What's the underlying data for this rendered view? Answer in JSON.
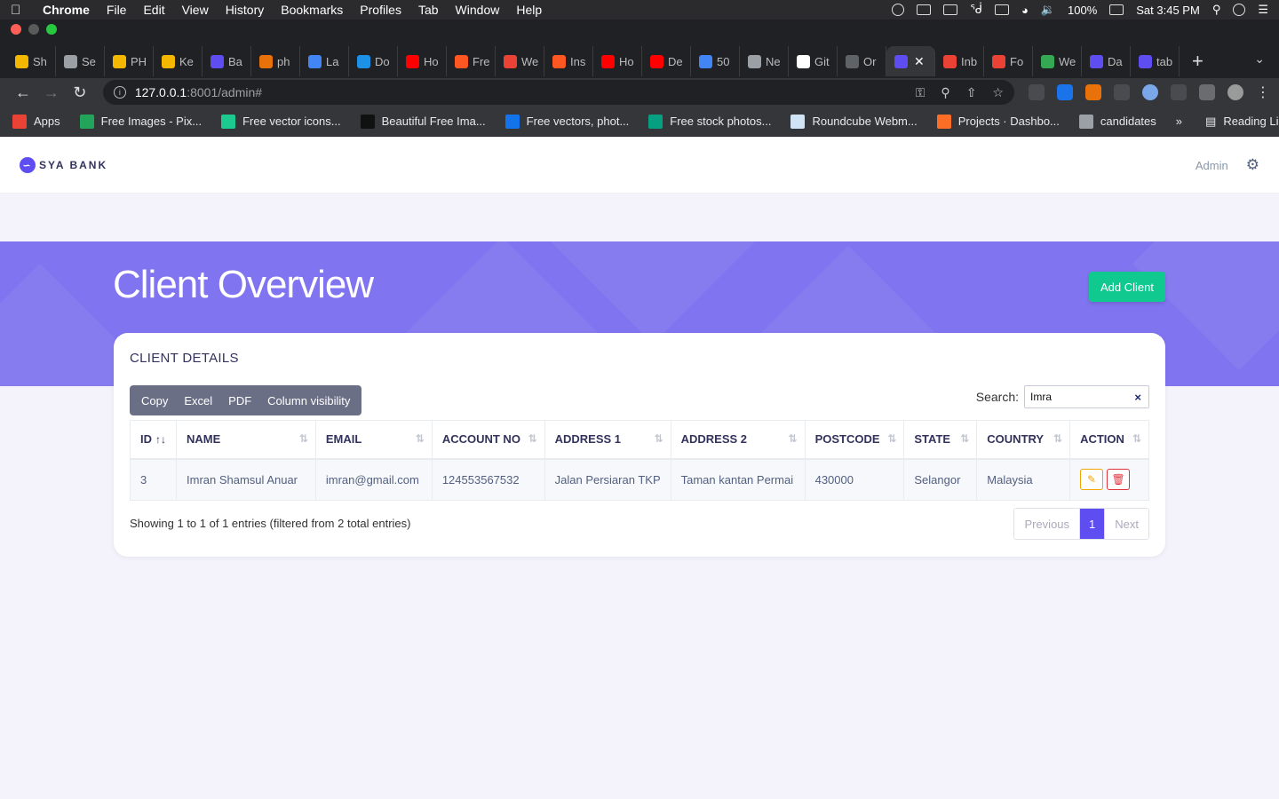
{
  "menubar": {
    "app": "Chrome",
    "items": [
      "File",
      "Edit",
      "View",
      "History",
      "Bookmarks",
      "Profiles",
      "Tab",
      "Window",
      "Help"
    ],
    "battery": "100%",
    "clock": "Sat 3:45 PM"
  },
  "tabs": [
    {
      "label": "Sh",
      "color": "#f5b800"
    },
    {
      "label": "Se",
      "color": "#9aa0a6"
    },
    {
      "label": "PH",
      "color": "#f5b800"
    },
    {
      "label": "Ke",
      "color": "#f5b800"
    },
    {
      "label": "Ba",
      "color": "#5e4df0"
    },
    {
      "label": "ph",
      "color": "#e8710a"
    },
    {
      "label": "La",
      "color": "#4285f4"
    },
    {
      "label": "Do",
      "color": "#1d91e6"
    },
    {
      "label": "Ho",
      "color": "#ff0000"
    },
    {
      "label": "Fre",
      "color": "#ff5722"
    },
    {
      "label": "We",
      "color": "#ea4335"
    },
    {
      "label": "Ins",
      "color": "#ff5722"
    },
    {
      "label": "Ho",
      "color": "#ff0000"
    },
    {
      "label": "De",
      "color": "#ff0000"
    },
    {
      "label": "50",
      "color": "#4285f4"
    },
    {
      "label": "Ne",
      "color": "#9aa0a6"
    },
    {
      "label": "Git",
      "color": "#ffffff"
    },
    {
      "label": "Or",
      "color": "#5f6368"
    },
    {
      "label": "",
      "color": "#5e4df0",
      "active": true
    },
    {
      "label": "Inb",
      "color": "#ea4335"
    },
    {
      "label": "Fo",
      "color": "#ea4335"
    },
    {
      "label": "We",
      "color": "#34a853"
    },
    {
      "label": "Da",
      "color": "#5e4df0"
    },
    {
      "label": "tab",
      "color": "#5e4df0"
    }
  ],
  "address": {
    "host": "127.0.0.1",
    "path": ":8001/admin#"
  },
  "bookmarks": [
    {
      "label": "Apps",
      "color": "#ea4335"
    },
    {
      "label": "Free Images - Pix...",
      "color": "#22a55b"
    },
    {
      "label": "Free vector icons...",
      "color": "#1cc98f"
    },
    {
      "label": "Beautiful Free Ima...",
      "color": "#111111"
    },
    {
      "label": "Free vectors, phot...",
      "color": "#1273eb"
    },
    {
      "label": "Free stock photos...",
      "color": "#05a081"
    },
    {
      "label": "Roundcube Webm...",
      "color": "#d0e4f5"
    },
    {
      "label": "Projects · Dashbo...",
      "color": "#fc6d26"
    },
    {
      "label": "candidates",
      "color": "#9aa0a6"
    }
  ],
  "bookmarks_more": "»",
  "reading_list": "Reading List",
  "app": {
    "brand": "SYA BANK",
    "user": "Admin",
    "page_title": "Client Overview",
    "add_button": "Add Client",
    "card_title": "CLIENT DETAILS",
    "export_buttons": [
      "Copy",
      "Excel",
      "PDF",
      "Column visibility"
    ],
    "search_label": "Search:",
    "search_value": "Imra",
    "columns": [
      "ID",
      "NAME",
      "EMAIL",
      "ACCOUNT NO",
      "ADDRESS 1",
      "ADDRESS 2",
      "POSTCODE",
      "STATE",
      "COUNTRY",
      "ACTION"
    ],
    "rows": [
      [
        "3",
        "Imran Shamsul Anuar",
        "imran@gmail.com",
        "124553567532",
        "Jalan Persiaran TKP",
        "Taman kantan Permai",
        "430000",
        "Selangor",
        "Malaysia"
      ]
    ],
    "info": "Showing 1 to 1 of 1 entries (filtered from 2 total entries)",
    "pager": {
      "prev": "Previous",
      "current": "1",
      "next": "Next"
    }
  },
  "colors": {
    "accent": "#5e4df0",
    "hero": "#8174f0",
    "success": "#10c98f"
  }
}
